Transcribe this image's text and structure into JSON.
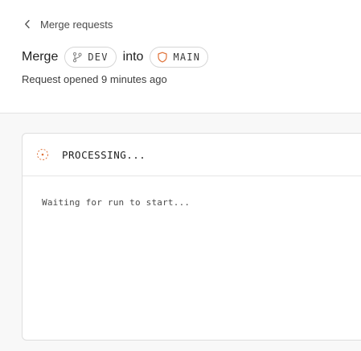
{
  "breadcrumb": {
    "back_label": "Merge requests",
    "icon": "chevron-left-icon"
  },
  "title": {
    "prefix": "Merge",
    "source_branch": "DEV",
    "source_icon": "git-branch-icon",
    "connector": "into",
    "target_branch": "MAIN",
    "target_icon": "shield-icon"
  },
  "subtitle": "Request opened 9 minutes ago",
  "status": {
    "label": "PROCESSING...",
    "icon": "spinner-icon",
    "color": "#e0733a"
  },
  "log": {
    "lines": [
      "Waiting for run to start..."
    ]
  },
  "colors": {
    "accent_orange": "#e0733a",
    "border": "#dedede",
    "panel_bg": "#f8f8f8"
  }
}
